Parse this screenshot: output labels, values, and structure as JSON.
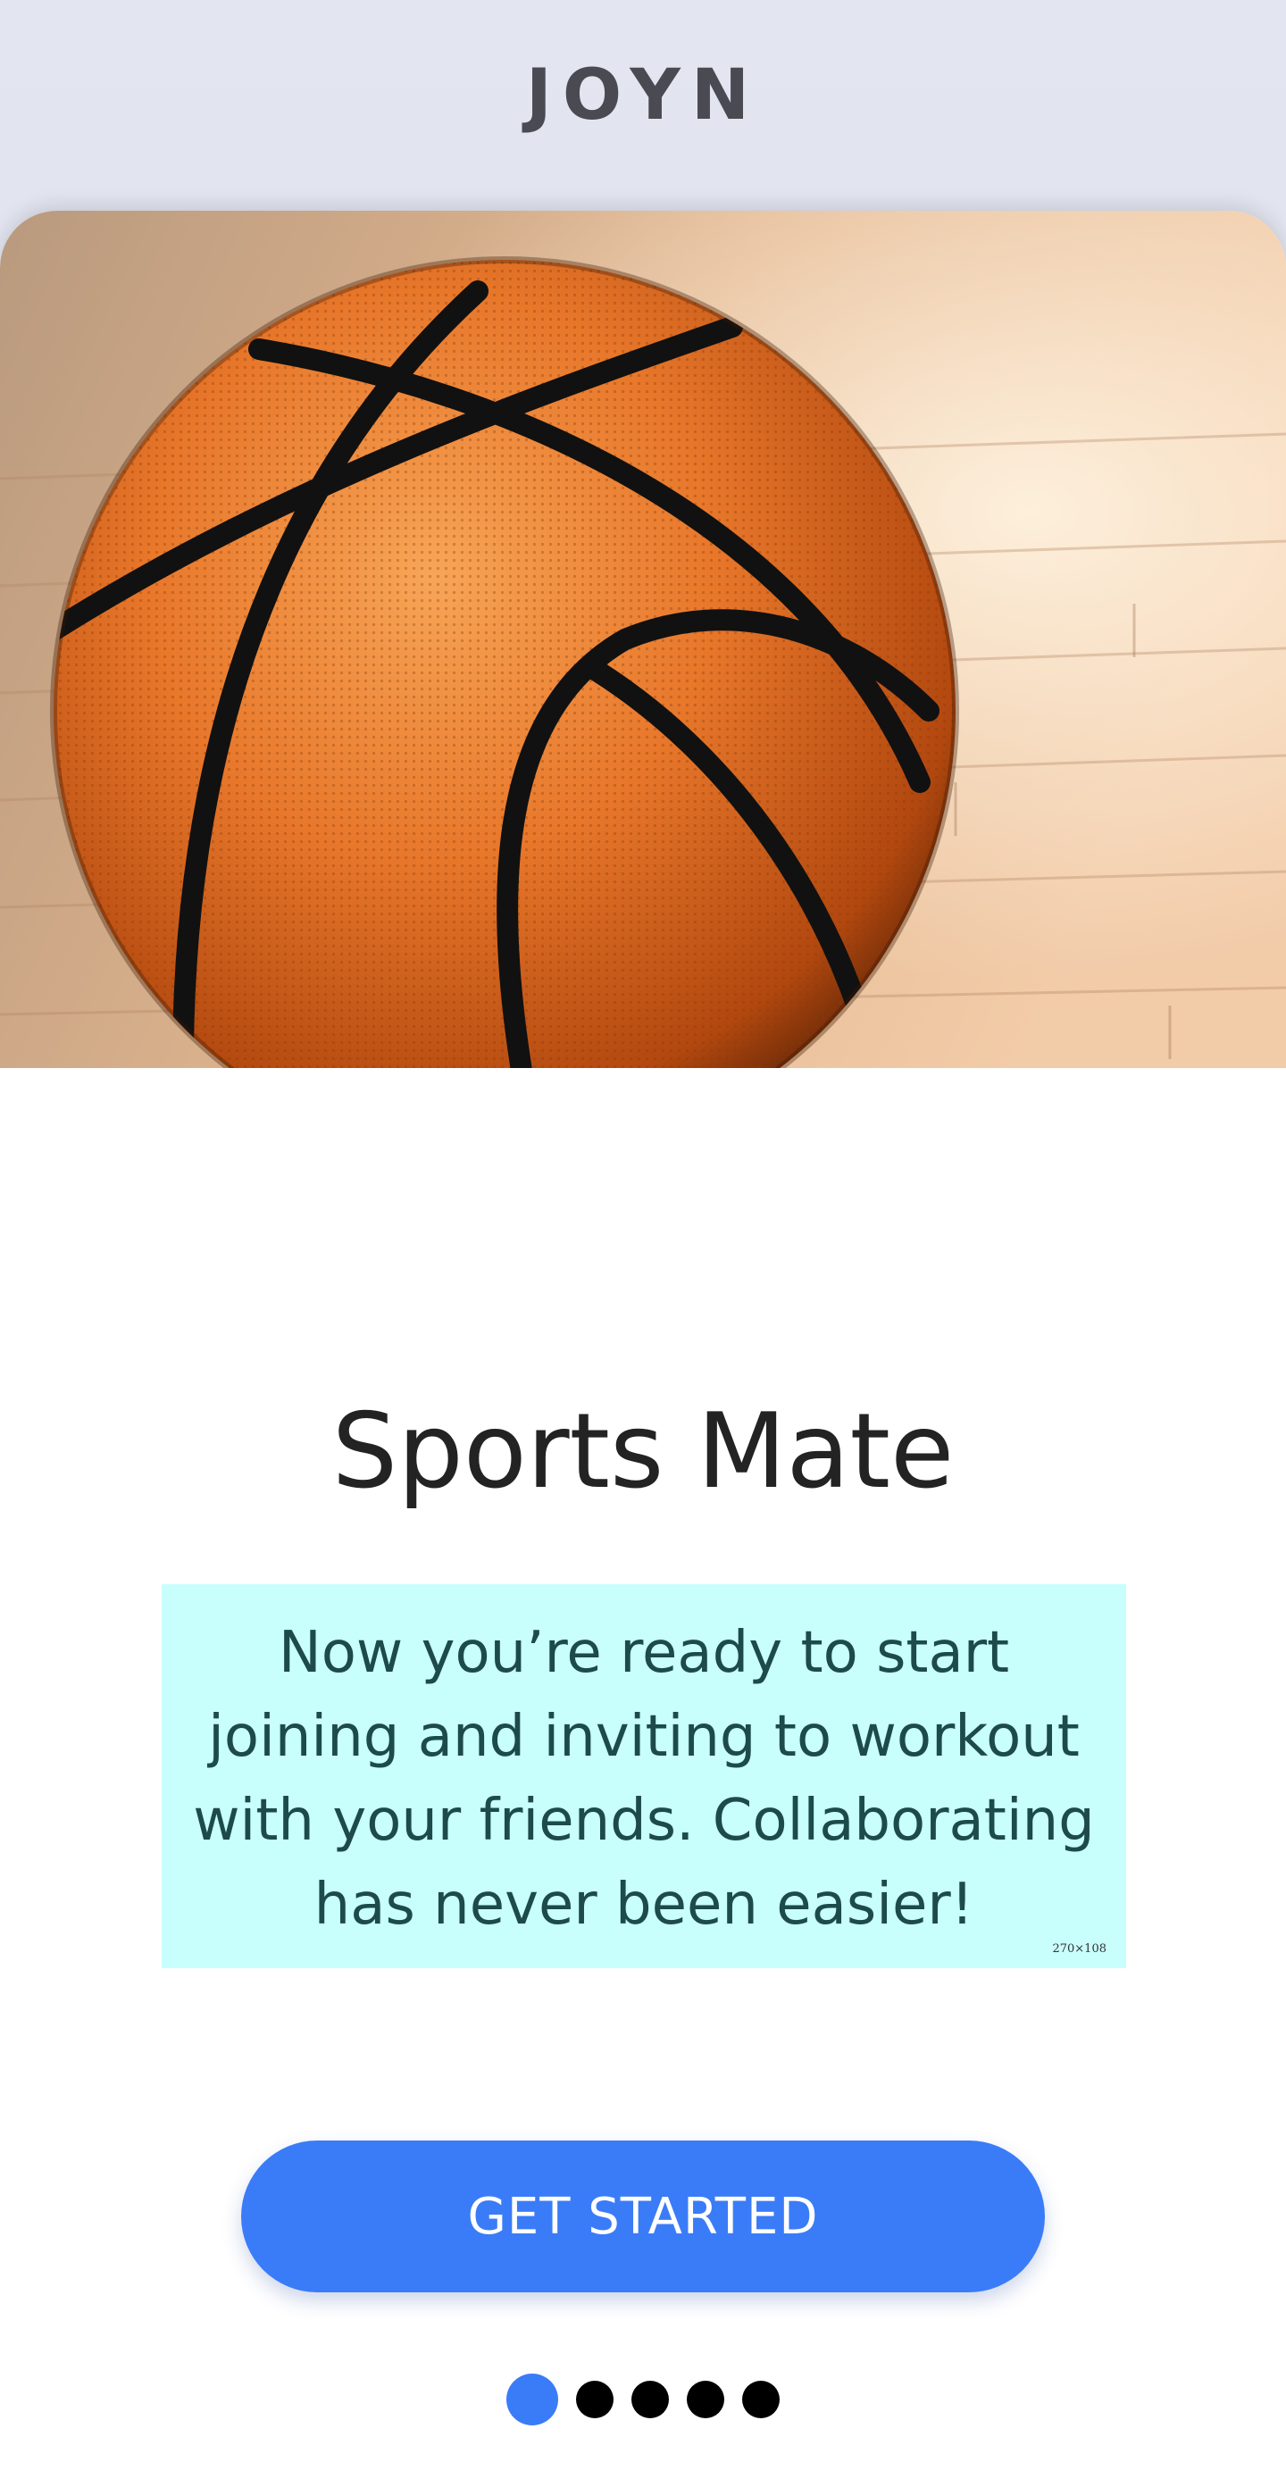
{
  "header": {
    "brand": "JOYN"
  },
  "hero": {
    "image": "basketball-on-hardwood-floor",
    "icon": "basketball-icon"
  },
  "onboarding": {
    "title": "Sports Mate",
    "description": "Now you’re ready to start joining and inviting to workout with your friends. Collaborating has never been easier!",
    "size_tag": "270×108",
    "cta_label": "GET STARTED"
  },
  "pager": {
    "total": 5,
    "active_index": 0
  },
  "colors": {
    "accent": "#3a7cf8",
    "description_bg": "#c8fffd",
    "brand_text": "#4a4b52"
  }
}
